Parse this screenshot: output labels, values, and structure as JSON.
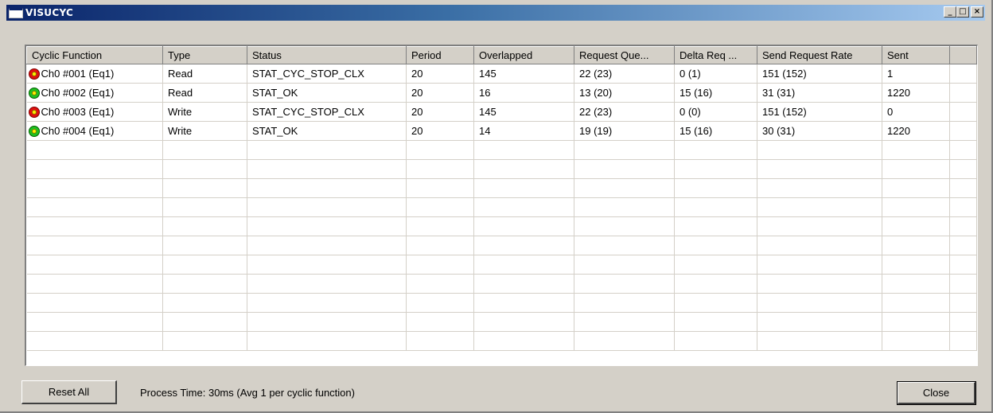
{
  "window": {
    "title": "VISUCYC"
  },
  "titlebar_buttons": {
    "minimize": "_",
    "maximize": "□",
    "close": "×"
  },
  "table": {
    "columns": [
      "Cyclic Function",
      "Type",
      "Status",
      "Period",
      "Overlapped",
      "Request Que...",
      "Delta Req ...",
      "Send Request Rate",
      "Sent",
      ""
    ],
    "rows": [
      {
        "icon": "red",
        "cells": [
          "Ch0 #001 (Eq1)",
          "Read",
          "STAT_CYC_STOP_CLX",
          "20",
          "145",
          "22 (23)",
          "0 (1)",
          "151 (152)",
          "1",
          ""
        ]
      },
      {
        "icon": "green",
        "cells": [
          "Ch0 #002 (Eq1)",
          "Read",
          "STAT_OK",
          "20",
          "16",
          "13 (20)",
          "15 (16)",
          "31 (31)",
          "1220",
          ""
        ]
      },
      {
        "icon": "red",
        "cells": [
          "Ch0 #003 (Eq1)",
          "Write",
          "STAT_CYC_STOP_CLX",
          "20",
          "145",
          "22 (23)",
          "0 (0)",
          "151 (152)",
          "0",
          ""
        ]
      },
      {
        "icon": "green",
        "cells": [
          "Ch0 #004 (Eq1)",
          "Write",
          "STAT_OK",
          "20",
          "14",
          "19 (19)",
          "15 (16)",
          "30 (31)",
          "1220",
          ""
        ]
      }
    ],
    "empty_rows": 11
  },
  "footer": {
    "reset_label": "Reset All",
    "process_text": "Process Time: 30ms (Avg 1 per cyclic function)",
    "close_label": "Close"
  },
  "colors": {
    "status_stopped": "#e01010",
    "status_ok": "#20c020",
    "titlebar": "#0a246a"
  },
  "icons": {
    "status_stopped": "status-red-icon",
    "status_ok": "status-green-icon"
  }
}
